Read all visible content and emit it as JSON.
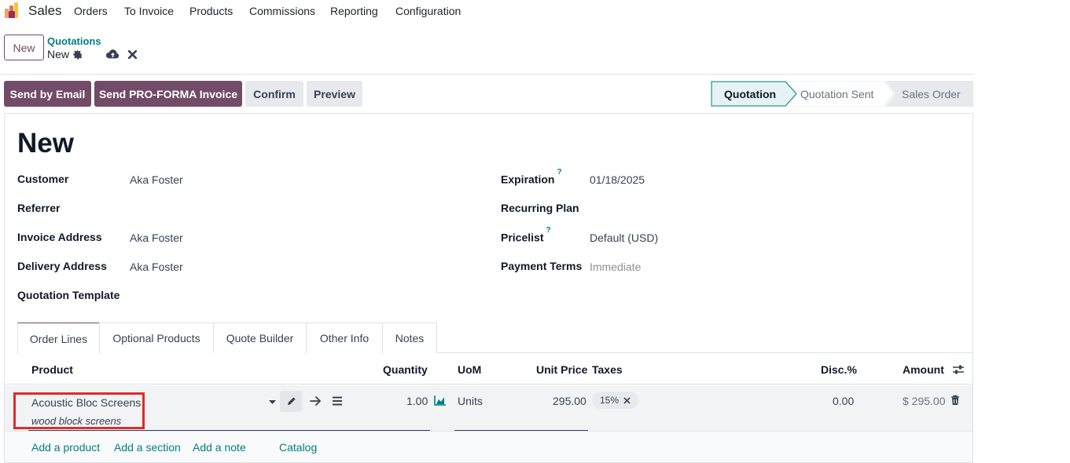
{
  "navbar": {
    "app_name": "Sales",
    "menu": [
      "Orders",
      "To Invoice",
      "Products",
      "Commissions",
      "Reporting",
      "Configuration"
    ]
  },
  "control_panel": {
    "new_button": "New",
    "breadcrumb_parent": "Quotations",
    "breadcrumb_current": "New"
  },
  "actions": {
    "send_email": "Send by Email",
    "send_proforma": "Send PRO-FORMA Invoice",
    "confirm": "Confirm",
    "preview": "Preview"
  },
  "status": {
    "stages": [
      "Quotation",
      "Quotation Sent",
      "Sales Order"
    ],
    "active": "Quotation"
  },
  "form": {
    "title": "New",
    "left": [
      {
        "label": "Customer",
        "value": "Aka Foster"
      },
      {
        "label": "Referrer",
        "value": ""
      },
      {
        "label": "Invoice Address",
        "value": "Aka Foster"
      },
      {
        "label": "Delivery Address",
        "value": "Aka Foster"
      },
      {
        "label": "Quotation Template",
        "value": ""
      }
    ],
    "right": [
      {
        "label": "Expiration",
        "value": "01/18/2025"
      },
      {
        "label": "Recurring Plan",
        "value": ""
      },
      {
        "label": "Pricelist",
        "value": "Default (USD)"
      },
      {
        "label": "Payment Terms",
        "value": "Immediate"
      }
    ],
    "help_mark": "?"
  },
  "tabs": [
    "Order Lines",
    "Optional Products",
    "Quote Builder",
    "Other Info",
    "Notes"
  ],
  "table": {
    "headers": {
      "product": "Product",
      "quantity": "Quantity",
      "uom": "UoM",
      "unit_price": "Unit Price",
      "taxes": "Taxes",
      "disc": "Disc.%",
      "amount": "Amount"
    },
    "row": {
      "product": "Acoustic Bloc Screens",
      "description": "wood block screens",
      "quantity": "1.00",
      "uom": "Units",
      "unit_price": "295.00",
      "tax": "15%",
      "disc": "0.00",
      "amount": "$ 295.00"
    },
    "footer_links": [
      "Add a product",
      "Add a section",
      "Add a note",
      "Catalog"
    ]
  },
  "colors": {
    "brand": "#714b67",
    "link": "#017e84",
    "highlight": "#e02b2b"
  }
}
